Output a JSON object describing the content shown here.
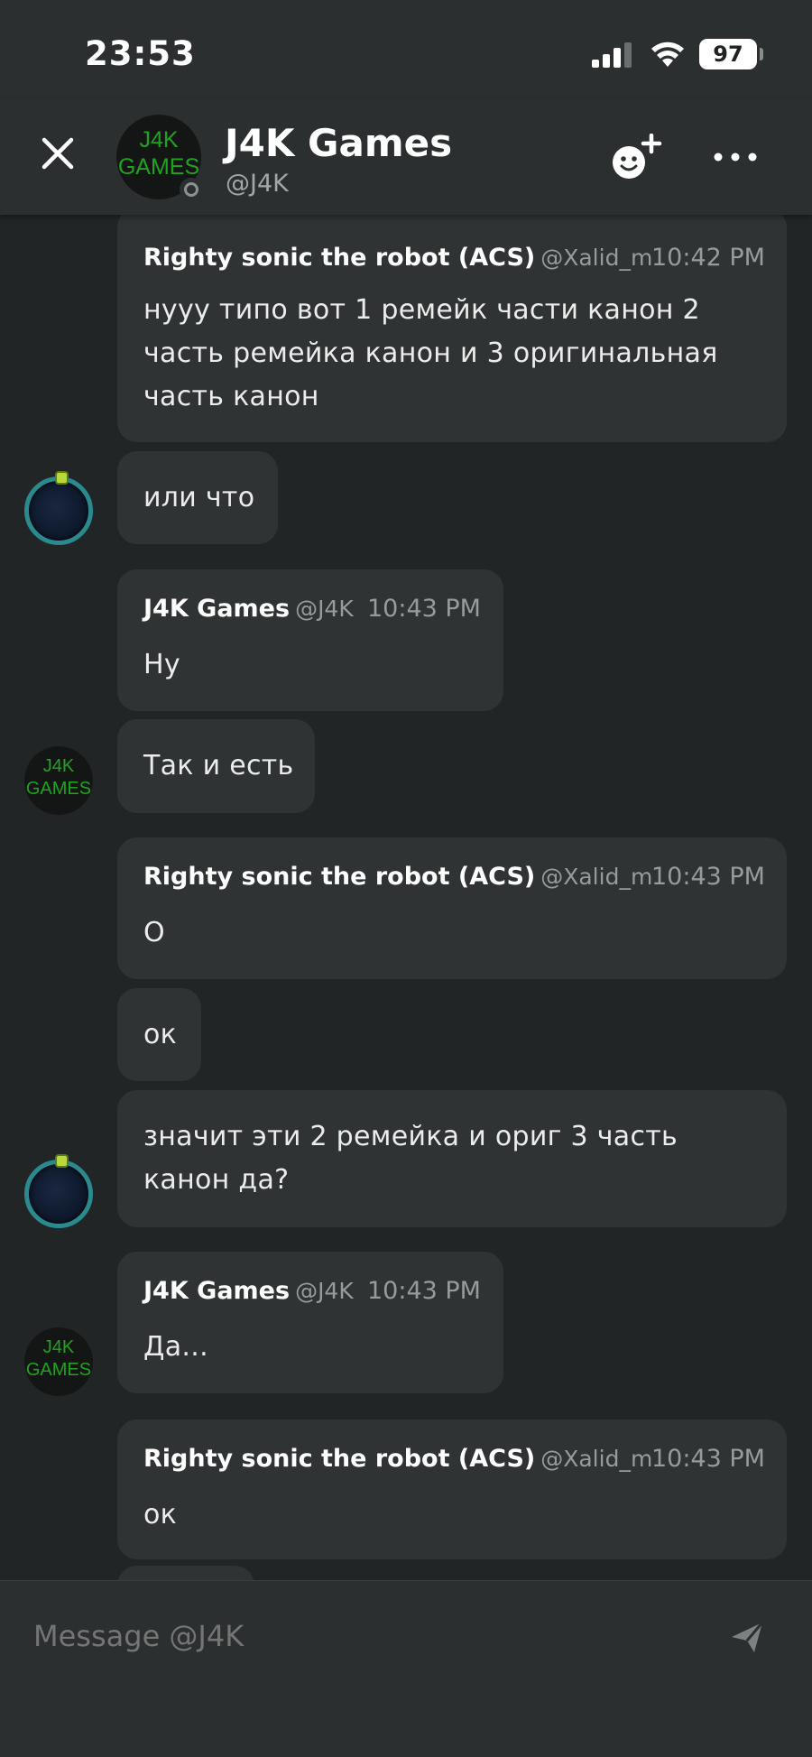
{
  "status_bar": {
    "time": "23:53",
    "battery": "97"
  },
  "header": {
    "title": "J4K Games",
    "handle": "@J4K",
    "avatar_logo_line1": "J4K",
    "avatar_logo_line2": "GAMES",
    "presence": "offline"
  },
  "messages": [
    {
      "author": "Righty sonic the robot (ACS)",
      "handle": "@Xalid_m",
      "time": "10:42 PM",
      "lines": [
        "нууу типо вот 1 ремейк части канон 2",
        "часть ремейка канон и 3 оригинальная",
        "часть канон"
      ]
    },
    {
      "text": "или что"
    },
    {
      "author": "J4K Games",
      "handle": "@J4K",
      "time": "10:43 PM",
      "text": "Ну"
    },
    {
      "text": "Так и есть"
    },
    {
      "author": "Righty sonic the robot (ACS)",
      "handle": "@Xalid_m",
      "time": "10:43 PM",
      "text": "О"
    },
    {
      "text": "ок"
    },
    {
      "lines": [
        "значит эти 2 ремейка и ориг 3 часть",
        "канон да?"
      ]
    },
    {
      "author": "J4K Games",
      "handle": "@J4K",
      "time": "10:43 PM",
      "text": "Да..."
    },
    {
      "author": "Righty sonic the robot (ACS)",
      "handle": "@Xalid_m",
      "time": "10:43 PM",
      "text": "ок"
    }
  ],
  "avatars": {
    "j4k_line1": "J4K",
    "j4k_line2": "GAMES"
  },
  "composer": {
    "placeholder": "Message @J4K"
  },
  "colors": {
    "background": "#212526",
    "bubble": "#2f3334",
    "logo_green": "#1fa31f",
    "orb_ring": "#2a8a8e"
  }
}
